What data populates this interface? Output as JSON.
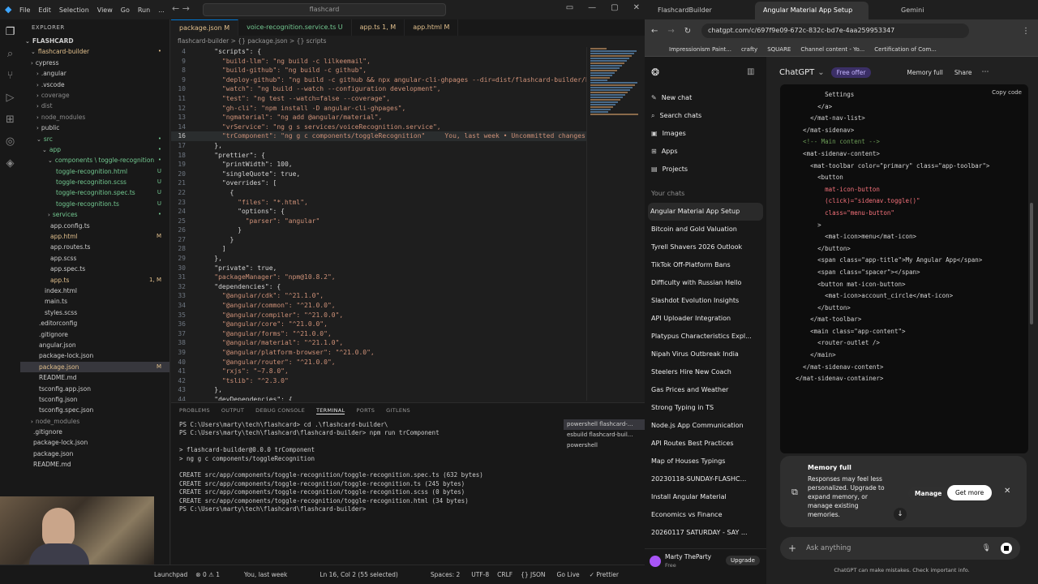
{
  "vscode": {
    "menu": [
      "File",
      "Edit",
      "Selection",
      "View",
      "Go",
      "Run",
      "..."
    ],
    "search": "flashcard",
    "explorer_title": "EXPLORER",
    "tree": [
      {
        "label": "FLASHCARD",
        "indent": 0,
        "arrow": "v",
        "status": "",
        "bold": true
      },
      {
        "label": "flashcard-builder",
        "indent": 1,
        "arrow": "v",
        "status": "•",
        "color": "#e2c08d"
      },
      {
        "label": "cypress",
        "indent": 1,
        "arrow": ">",
        "status": ""
      },
      {
        "label": ".angular",
        "indent": 2,
        "arrow": ">",
        "status": ""
      },
      {
        "label": ".vscode",
        "indent": 2,
        "arrow": ">",
        "status": ""
      },
      {
        "label": "coverage",
        "indent": 2,
        "arrow": ">",
        "status": "",
        "color": "#8c8c8c"
      },
      {
        "label": "dist",
        "indent": 2,
        "arrow": ">",
        "status": "",
        "color": "#8c8c8c"
      },
      {
        "label": "node_modules",
        "indent": 2,
        "arrow": ">",
        "status": "",
        "color": "#8c8c8c"
      },
      {
        "label": "public",
        "indent": 2,
        "arrow": ">",
        "status": ""
      },
      {
        "label": "src",
        "indent": 2,
        "arrow": "v",
        "status": "•",
        "color": "#73c991"
      },
      {
        "label": "app",
        "indent": 3,
        "arrow": "v",
        "status": "•",
        "color": "#73c991"
      },
      {
        "label": "components \\ toggle-recognition",
        "indent": 4,
        "arrow": "v",
        "status": "•",
        "color": "#73c991"
      },
      {
        "label": "toggle-recognition.html",
        "indent": 5,
        "arrow": "",
        "status": "U",
        "color": "#73c991"
      },
      {
        "label": "toggle-recognition.scss",
        "indent": 5,
        "arrow": "",
        "status": "U",
        "color": "#73c991"
      },
      {
        "label": "toggle-recognition.spec.ts",
        "indent": 5,
        "arrow": "",
        "status": "U",
        "color": "#73c991"
      },
      {
        "label": "toggle-recognition.ts",
        "indent": 5,
        "arrow": "",
        "status": "U",
        "color": "#73c991"
      },
      {
        "label": "services",
        "indent": 4,
        "arrow": ">",
        "status": "•",
        "color": "#73c991"
      },
      {
        "label": "app.config.ts",
        "indent": 4,
        "arrow": "",
        "status": ""
      },
      {
        "label": "app.html",
        "indent": 4,
        "arrow": "",
        "status": "M",
        "color": "#e2c08d"
      },
      {
        "label": "app.routes.ts",
        "indent": 4,
        "arrow": "",
        "status": ""
      },
      {
        "label": "app.scss",
        "indent": 4,
        "arrow": "",
        "status": ""
      },
      {
        "label": "app.spec.ts",
        "indent": 4,
        "arrow": "",
        "status": ""
      },
      {
        "label": "app.ts",
        "indent": 4,
        "arrow": "",
        "status": "1, M",
        "color": "#e2c08d"
      },
      {
        "label": "index.html",
        "indent": 3,
        "arrow": "",
        "status": ""
      },
      {
        "label": "main.ts",
        "indent": 3,
        "arrow": "",
        "status": ""
      },
      {
        "label": "styles.scss",
        "indent": 3,
        "arrow": "",
        "status": ""
      },
      {
        "label": ".editorconfig",
        "indent": 2,
        "arrow": "",
        "status": ""
      },
      {
        "label": ".gitignore",
        "indent": 2,
        "arrow": "",
        "status": ""
      },
      {
        "label": "angular.json",
        "indent": 2,
        "arrow": "",
        "status": ""
      },
      {
        "label": "package-lock.json",
        "indent": 2,
        "arrow": "",
        "status": ""
      },
      {
        "label": "package.json",
        "indent": 2,
        "arrow": "",
        "status": "M",
        "color": "#e2c08d",
        "selected": true
      },
      {
        "label": "README.md",
        "indent": 2,
        "arrow": "",
        "status": ""
      },
      {
        "label": "tsconfig.app.json",
        "indent": 2,
        "arrow": "",
        "status": ""
      },
      {
        "label": "tsconfig.json",
        "indent": 2,
        "arrow": "",
        "status": ""
      },
      {
        "label": "tsconfig.spec.json",
        "indent": 2,
        "arrow": "",
        "status": ""
      },
      {
        "label": "node_modules",
        "indent": 1,
        "arrow": ">",
        "status": "",
        "color": "#8c8c8c"
      },
      {
        "label": ".gitignore",
        "indent": 1,
        "arrow": "",
        "status": ""
      },
      {
        "label": "package-lock.json",
        "indent": 1,
        "arrow": "",
        "status": ""
      },
      {
        "label": "package.json",
        "indent": 1,
        "arrow": "",
        "status": ""
      },
      {
        "label": "README.md",
        "indent": 1,
        "arrow": "",
        "status": ""
      }
    ],
    "tabs": [
      {
        "label": "package.json M",
        "active": true
      },
      {
        "label": "voice-recognition.service.ts U",
        "active": false
      },
      {
        "label": "app.ts 1, M",
        "active": false
      },
      {
        "label": "app.html M",
        "active": false
      }
    ],
    "breadcrumb": "flashcard-builder > {} package.json > {} scripts",
    "code": [
      {
        "n": "4",
        "t": "    \"scripts\": {"
      },
      {
        "n": "9",
        "t": "      \"build-llm\": \"ng build -c lilkeemail\","
      },
      {
        "n": "8",
        "t": "      \"build-github\": \"ng build -c github\","
      },
      {
        "n": "9",
        "t": "      \"deploy-github\": \"ng build -c github && npx angular-cli-ghpages --dir=dist/flashcard-builder/br"
      },
      {
        "n": "10",
        "t": "      \"watch\": \"ng build --watch --configuration development\","
      },
      {
        "n": "11",
        "t": "      \"test\": \"ng test --watch=false --coverage\","
      },
      {
        "n": "12",
        "t": "      \"gh-cli\": \"npm install -D angular-cli-ghpages\","
      },
      {
        "n": "13",
        "t": "      \"ngmaterial\": \"ng add @angular/material\","
      },
      {
        "n": "14",
        "t": "      \"vrService\": \"ng g s services/voiceRecognition.service\","
      },
      {
        "n": "16",
        "t": "      \"trComponent\": \"ng g c components/toggleRecognition\"     You, last week • Uncommitted changes",
        "cur": true
      },
      {
        "n": "17",
        "t": "    },"
      },
      {
        "n": "18",
        "t": "    \"prettier\": {"
      },
      {
        "n": "19",
        "t": "      \"printWidth\": 100,"
      },
      {
        "n": "20",
        "t": "      \"singleQuote\": true,"
      },
      {
        "n": "21",
        "t": "      \"overrides\": ["
      },
      {
        "n": "22",
        "t": "        {"
      },
      {
        "n": "23",
        "t": "          \"files\": \"*.html\","
      },
      {
        "n": "24",
        "t": "          \"options\": {"
      },
      {
        "n": "25",
        "t": "            \"parser\": \"angular\""
      },
      {
        "n": "26",
        "t": "          }"
      },
      {
        "n": "27",
        "t": "        }"
      },
      {
        "n": "28",
        "t": "      ]"
      },
      {
        "n": "29",
        "t": "    },"
      },
      {
        "n": "30",
        "t": "    \"private\": true,"
      },
      {
        "n": "31",
        "t": "    \"packageManager\": \"npm@10.8.2\","
      },
      {
        "n": "32",
        "t": "    \"dependencies\": {"
      },
      {
        "n": "33",
        "t": "      \"@angular/cdk\": \"^21.1.0\","
      },
      {
        "n": "34",
        "t": "      \"@angular/common\": \"^21.0.0\","
      },
      {
        "n": "35",
        "t": "      \"@angular/compiler\": \"^21.0.0\","
      },
      {
        "n": "36",
        "t": "      \"@angular/core\": \"^21.0.0\","
      },
      {
        "n": "37",
        "t": "      \"@angular/forms\": \"^21.0.0\","
      },
      {
        "n": "38",
        "t": "      \"@angular/material\": \"^21.1.0\","
      },
      {
        "n": "39",
        "t": "      \"@angular/platform-browser\": \"^21.0.0\","
      },
      {
        "n": "40",
        "t": "      \"@angular/router\": \"^21.0.0\","
      },
      {
        "n": "41",
        "t": "      \"rxjs\": \"~7.8.0\","
      },
      {
        "n": "42",
        "t": "      \"tslib\": \"^2.3.0\""
      },
      {
        "n": "43",
        "t": "    },"
      },
      {
        "n": "44",
        "t": "    \"devDependencies\": {"
      }
    ],
    "panel_tabs": [
      "PROBLEMS",
      "OUTPUT",
      "DEBUG CONSOLE",
      "TERMINAL",
      "PORTS",
      "GITLENS"
    ],
    "problems_count": "1",
    "terminal": "PS C:\\Users\\marty\\tech\\flashcard> cd .\\flashcard-builder\\\nPS C:\\Users\\marty\\tech\\flashcard\\flashcard-builder> npm run trComponent\n\n> flashcard-builder@0.0.0 trComponent\n> ng g c components/toggleRecognition\n\nCREATE src/app/components/toggle-recognition/toggle-recognition.spec.ts (632 bytes)\nCREATE src/app/components/toggle-recognition/toggle-recognition.ts (245 bytes)\nCREATE src/app/components/toggle-recognition/toggle-recognition.scss (0 bytes)\nCREATE src/app/components/toggle-recognition/toggle-recognition.html (34 bytes)\nPS C:\\Users\\marty\\tech\\flashcard\\flashcard-builder> ",
    "terminal_list": [
      "powershell flashcard-...",
      "esbuild flashcard-buil...",
      "powershell"
    ],
    "status": {
      "launchpad": "Launchpad",
      "errors": "⊗ 0 ⚠ 1",
      "blame": "You, last week",
      "pos": "Ln 16, Col 2 (55 selected)",
      "spaces": "Spaces: 2",
      "enc": "UTF-8",
      "eol": "CRLF",
      "lang": "{} JSON",
      "golive": "Go Live",
      "prettier": "✓ Prettier"
    }
  },
  "chrome": {
    "tabs": [
      "FlashcardBuilder",
      "Angular Material App Setup",
      "Gemini"
    ],
    "url": "chatgpt.com/c/697f9e09-672c-832c-bd7e-4aa259953347",
    "bookmarks": [
      "Impressionism Paint...",
      "crafty",
      "SQUARE",
      "Channel content - Yo...",
      "Certification of Com..."
    ],
    "sidebar": {
      "actions": [
        "New chat",
        "Search chats",
        "Images",
        "Apps",
        "Projects"
      ],
      "your_chats": "Your chats",
      "chats": [
        "Angular Material App Setup",
        "Bitcoin and Gold Valuation",
        "Tyrell Shavers 2026 Outlook",
        "TikTok Off-Platform Bans",
        "Difficulty with Russian Hello",
        "Slashdot Evolution Insights",
        "API Uploader Integration",
        "Platypus Characteristics Expl...",
        "Nipah Virus Outbreak India",
        "Steelers Hire New Coach",
        "Gas Prices and Weather",
        "Strong Typing in TS",
        "Node.js App Communication",
        "API Routes Best Practices",
        "Map of Houses Typings",
        "20230118-SUNDAY-FLASHC...",
        "Install Angular Material",
        "Economics vs Finance",
        "20260117 SATURDAY - SAY ..."
      ],
      "user": "Marty TheParty",
      "plan": "Free",
      "upgrade": "Upgrade"
    },
    "header": {
      "title": "ChatGPT",
      "offer": "Free offer",
      "memory": "Memory full",
      "share": "Share"
    },
    "copy_code": "Copy code",
    "code_lines": [
      "          Settings",
      "        </a>",
      "      </mat-nav-list>",
      "    </mat-sidenav>",
      "",
      "    <!-- Main content -->",
      "    <mat-sidenav-content>",
      "      <mat-toolbar color=\"primary\" class=\"app-toolbar\">",
      "        <button",
      "          mat-icon-button",
      "          (click)=\"sidenav.toggle()\"",
      "          class=\"menu-button\"",
      "        >",
      "          <mat-icon>menu</mat-icon>",
      "        </button>",
      "",
      "        <span class=\"app-title\">My Angular App</span>",
      "",
      "        <span class=\"spacer\"></span>",
      "",
      "        <button mat-icon-button>",
      "          <mat-icon>account_circle</mat-icon>",
      "        </button>",
      "      </mat-toolbar>",
      "",
      "      <main class=\"app-content\">",
      "        <router-outlet />",
      "      </main>",
      "    </mat-sidenav-content>",
      "  </mat-sidenav-container>"
    ],
    "memory_card": {
      "title": "Memory full",
      "body": "Responses may feel less personalized. Upgrade to expand memory, or manage existing memories.",
      "manage": "Manage",
      "get_more": "Get more"
    },
    "input_placeholder": "Ask anything",
    "disclaimer": "ChatGPT can make mistakes. Check important info."
  }
}
